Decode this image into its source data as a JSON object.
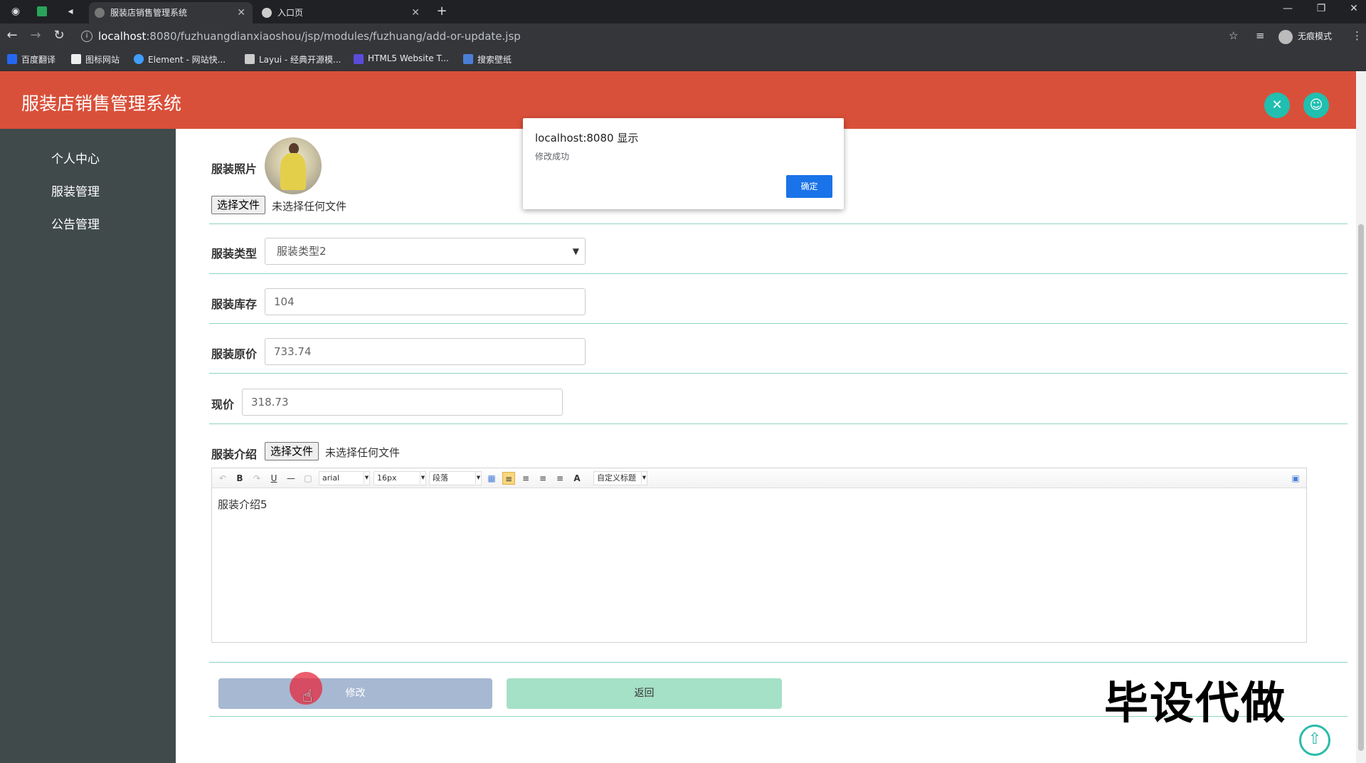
{
  "browser": {
    "tabs": [
      {
        "title": "服装店销售管理系统",
        "active": true
      },
      {
        "title": "入口页",
        "active": false
      }
    ],
    "url_host": "localhost",
    "url_path": ":8080/fuzhuangdianxiaoshou/jsp/modules/fuzhuang/add-or-update.jsp",
    "incognito_label": "无痕模式",
    "bookmarks": [
      {
        "label": "百度翻译",
        "icon": "baidu-translate-icon",
        "color": "#2468f2"
      },
      {
        "label": "图标网站",
        "icon": "flag-icon",
        "color": "#eeeeee"
      },
      {
        "label": "Element - 网站快...",
        "icon": "element-icon",
        "color": "#409eff"
      },
      {
        "label": "Layui - 经典开源模...",
        "icon": "layui-icon",
        "color": "#cccccc"
      },
      {
        "label": "HTML5 Website T...",
        "icon": "html5-icon",
        "color": "#5b4bdb"
      },
      {
        "label": "搜索壁纸",
        "icon": "wallpaper-icon",
        "color": "#4a7fd8"
      }
    ]
  },
  "app": {
    "title": "服装店销售管理系统",
    "sidebar": {
      "items": [
        {
          "label": "个人中心"
        },
        {
          "label": "服装管理"
        },
        {
          "label": "公告管理"
        }
      ]
    },
    "form": {
      "photo_label": "服装照片",
      "file_button": "选择文件",
      "no_file": "未选择任何文件",
      "type_label": "服装类型",
      "type_value": "服装类型2",
      "stock_label": "服装库存",
      "stock_value": "104",
      "original_price_label": "服装原价",
      "original_price_value": "733.74",
      "current_price_label": "现价",
      "current_price_value": "318.73",
      "intro_label": "服装介绍",
      "intro_file_button": "选择文件",
      "intro_no_file": "未选择任何文件",
      "editor": {
        "font_family": "arial",
        "font_size": "16px",
        "paragraph": "段落",
        "custom_title": "自定义标题",
        "content": "服装介绍5"
      },
      "modify_button": "修改",
      "back_button": "返回"
    },
    "watermark": "毕设代做"
  },
  "dialog": {
    "title": "localhost:8080 显示",
    "message": "修改成功",
    "ok": "确定"
  },
  "colors": {
    "header": "#d9503a",
    "sidebar": "#404a4b",
    "accent": "#20bfb0",
    "modify": "#a7b8d2",
    "back": "#a5e1c7",
    "dialog_ok": "#1a73e8"
  }
}
